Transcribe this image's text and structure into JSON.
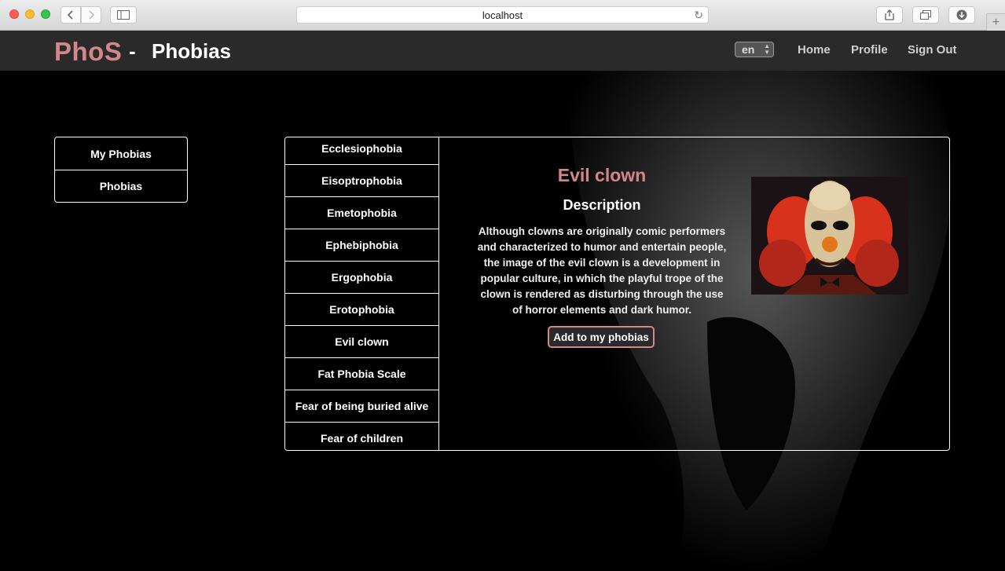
{
  "browser": {
    "url": "localhost"
  },
  "site": {
    "brand": "PhoS",
    "separator": "-",
    "page_heading": "Phobias",
    "language": "en",
    "nav": {
      "home": "Home",
      "profile": "Profile",
      "signout": "Sign Out"
    },
    "accent_color": "#d4878a"
  },
  "leftmenu": {
    "items": [
      {
        "label": "My Phobias"
      },
      {
        "label": "Phobias"
      }
    ]
  },
  "phobias": {
    "items": [
      {
        "label": "Ecclesiophobia"
      },
      {
        "label": "Eisoptrophobia"
      },
      {
        "label": "Emetophobia"
      },
      {
        "label": "Ephebiphobia"
      },
      {
        "label": "Ergophobia"
      },
      {
        "label": "Erotophobia"
      },
      {
        "label": "Evil clown"
      },
      {
        "label": "Fat Phobia Scale"
      },
      {
        "label": "Fear of being buried alive"
      },
      {
        "label": "Fear of children"
      }
    ]
  },
  "detail": {
    "title": "Evil clown",
    "subtitle": "Description",
    "text": "Although clowns are originally comic performers and characterized to humor and entertain people, the image of the evil clown is a development in popular culture, in which the playful trope of the clown is rendered as disturbing through the use of horror elements and dark humor.",
    "add_button": "Add to my phobias"
  }
}
